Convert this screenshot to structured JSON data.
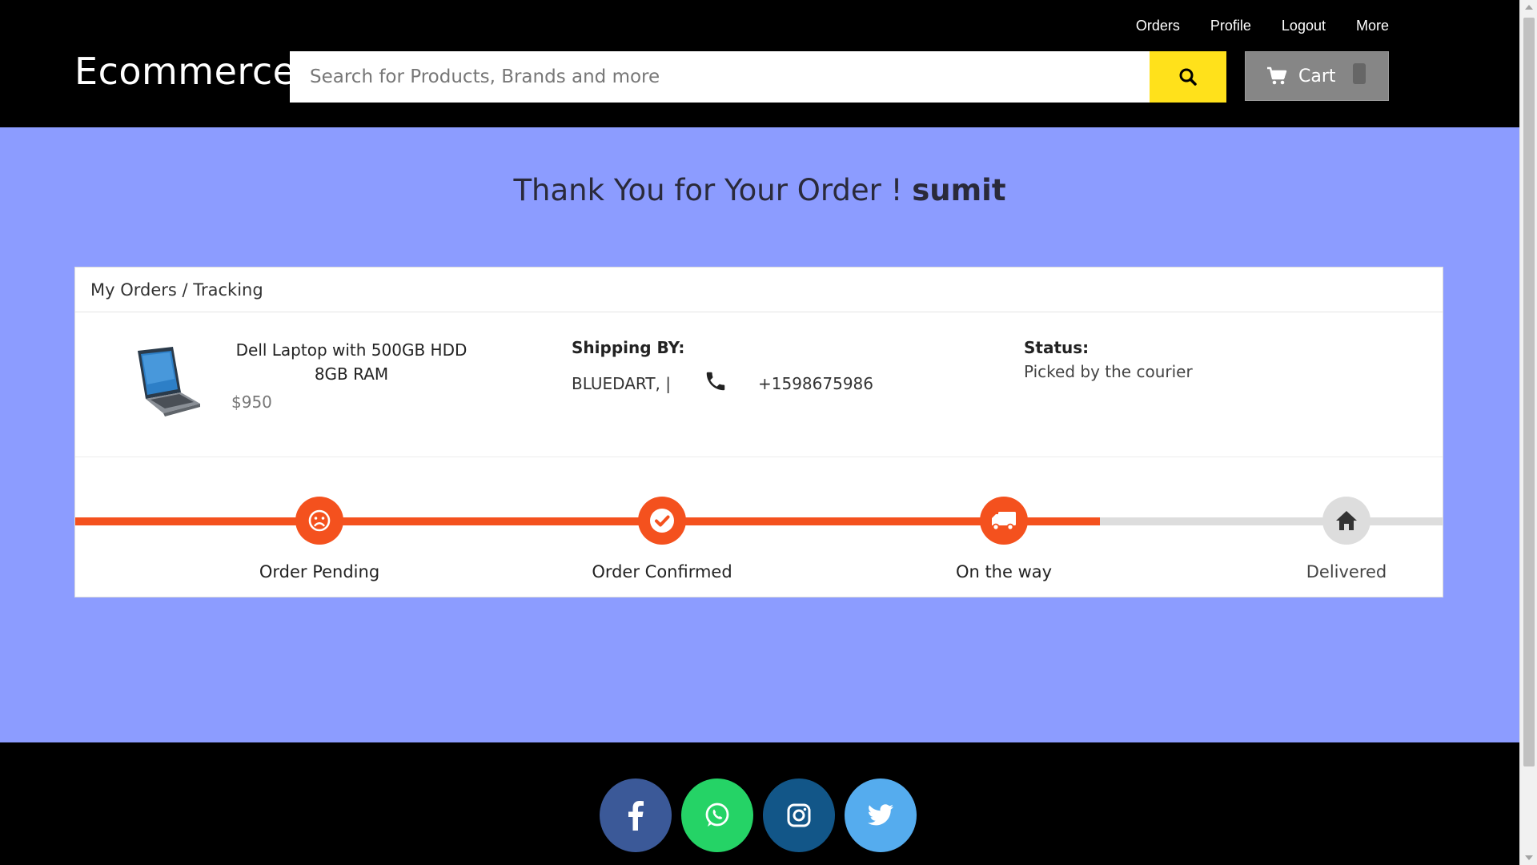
{
  "header": {
    "brand": "Ecommerce",
    "links": [
      "Orders",
      "Profile",
      "Logout",
      "More"
    ],
    "search_placeholder": "Search for Products, Brands and more",
    "cart_label": "Cart"
  },
  "thanks": {
    "text": "Thank You for Your Order ! ",
    "user": "sumit"
  },
  "card": {
    "breadcrumb": "My Orders / Tracking",
    "product": {
      "name": "Dell Laptop with 500GB HDD 8GB RAM",
      "price": "$950",
      "image_icon": "laptop-image"
    },
    "shipping": {
      "label": "Shipping BY:",
      "carrier": "BLUEDART, |",
      "phone": "+1598675986",
      "phone_icon": "phone-icon"
    },
    "status": {
      "label": "Status:",
      "value": "Picked by the courier"
    },
    "progress": 0.75,
    "steps": [
      {
        "label": "Order Pending",
        "icon": "frown-icon",
        "done": true
      },
      {
        "label": "Order Confirmed",
        "icon": "check-icon",
        "done": true
      },
      {
        "label": "On the way",
        "icon": "truck-icon",
        "done": true
      },
      {
        "label": "Delivered",
        "icon": "home-icon",
        "done": false
      }
    ]
  },
  "footer": {
    "socials": [
      {
        "name": "facebook",
        "color": "#3b5998"
      },
      {
        "name": "whatsapp",
        "color": "#25d366"
      },
      {
        "name": "instagram",
        "color": "#125688"
      },
      {
        "name": "twitter",
        "color": "#55acee"
      }
    ]
  },
  "colors": {
    "accent": "#f4511e",
    "search_button": "#ffe11b",
    "page_bg": "#8c9cff"
  }
}
